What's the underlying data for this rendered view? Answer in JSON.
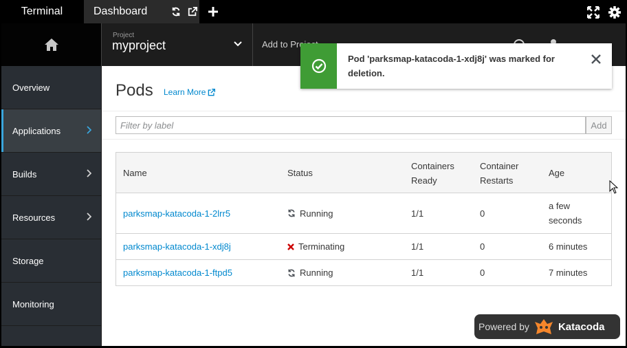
{
  "tabs": {
    "terminal": "Terminal",
    "dashboard": "Dashboard"
  },
  "icons": {
    "refresh": "refresh-icon",
    "popout": "external-link-icon",
    "add": "plus-icon",
    "expand": "expand-icon",
    "settings": "gear-icon",
    "home": "home-icon",
    "success": "check-circle-icon",
    "close": "close-icon"
  },
  "header": {
    "project_caption": "Project",
    "project_name": "myproject",
    "add_to_project": "Add to Project"
  },
  "sidebar": {
    "items": [
      {
        "label": "Overview",
        "has_chevron": false
      },
      {
        "label": "Applications",
        "has_chevron": true,
        "active": true
      },
      {
        "label": "Builds",
        "has_chevron": true
      },
      {
        "label": "Resources",
        "has_chevron": true
      },
      {
        "label": "Storage",
        "has_chevron": false
      },
      {
        "label": "Monitoring",
        "has_chevron": false
      }
    ]
  },
  "main": {
    "title": "Pods",
    "learn_more": "Learn More",
    "filter_placeholder": "Filter by label",
    "add_button": "Add"
  },
  "table": {
    "columns": [
      "Name",
      "Status",
      "Containers Ready",
      "Container Restarts",
      "Age"
    ],
    "rows": [
      {
        "name": "parksmap-katacoda-1-2lrr5",
        "status": "Running",
        "ready": "1/1",
        "restarts": "0",
        "age": "a few seconds"
      },
      {
        "name": "parksmap-katacoda-1-xdj8j",
        "status": "Terminating",
        "ready": "1/1",
        "restarts": "0",
        "age": "6 minutes"
      },
      {
        "name": "parksmap-katacoda-1-ftpd5",
        "status": "Running",
        "ready": "1/1",
        "restarts": "0",
        "age": "7 minutes"
      }
    ]
  },
  "toast": {
    "message": "Pod 'parksmap-katacoda-1-xdj8j' was marked for deletion."
  },
  "powered": {
    "prefix": "Powered by",
    "brand": "Katacoda"
  },
  "colors": {
    "accent": "#0088ce",
    "success": "#3f9c35",
    "danger": "#cc0000",
    "active_bar": "#39a5dc"
  }
}
